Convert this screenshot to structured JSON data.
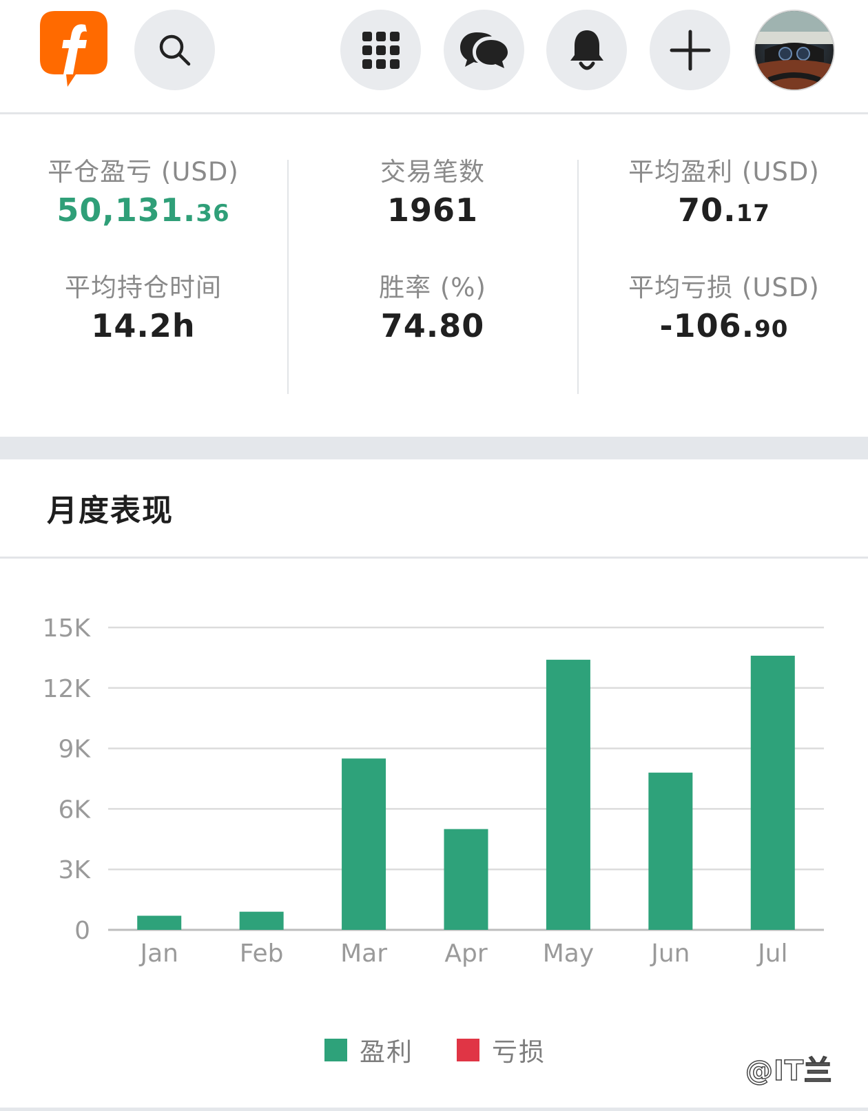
{
  "header": {
    "icons": [
      "app-logo",
      "search-icon",
      "apps-grid-icon",
      "chat-icon",
      "bell-icon",
      "plus-icon",
      "avatar"
    ]
  },
  "stats": {
    "closed_pnl": {
      "label": "平仓盈亏 (USD)",
      "int": "50,131.",
      "dec": "36"
    },
    "trade_count": {
      "label": "交易笔数",
      "value": "1961"
    },
    "avg_profit": {
      "label": "平均盈利 (USD)",
      "int": "70.",
      "dec": "17"
    },
    "avg_hold_time": {
      "label": "平均持仓时间",
      "value": "14.2h"
    },
    "win_rate": {
      "label": "胜率 (%)",
      "value": "74.80"
    },
    "avg_loss": {
      "label": "平均亏损 (USD)",
      "int": "-106.",
      "dec": "90"
    }
  },
  "monthly": {
    "title": "月度表现"
  },
  "chart_data": {
    "type": "bar",
    "categories": [
      "Jan",
      "Feb",
      "Mar",
      "Apr",
      "May",
      "Jun",
      "Jul"
    ],
    "series": [
      {
        "name": "盈利",
        "values": [
          700,
          900,
          8500,
          5000,
          13400,
          7800,
          13600
        ]
      },
      {
        "name": "亏损",
        "values": [
          0,
          0,
          0,
          0,
          0,
          0,
          0
        ]
      }
    ],
    "yticks": [
      "0",
      "3K",
      "6K",
      "9K",
      "12K",
      "15K"
    ],
    "ylim": [
      0,
      15000
    ],
    "grid": true,
    "legend": "bottom-center"
  },
  "legend": {
    "profit_label": "盈利",
    "loss_label": "亏损"
  },
  "colors": {
    "profit": "#2ea27a",
    "loss": "#e03545",
    "logo": "#ff6a00"
  },
  "watermark": "@IT兰"
}
